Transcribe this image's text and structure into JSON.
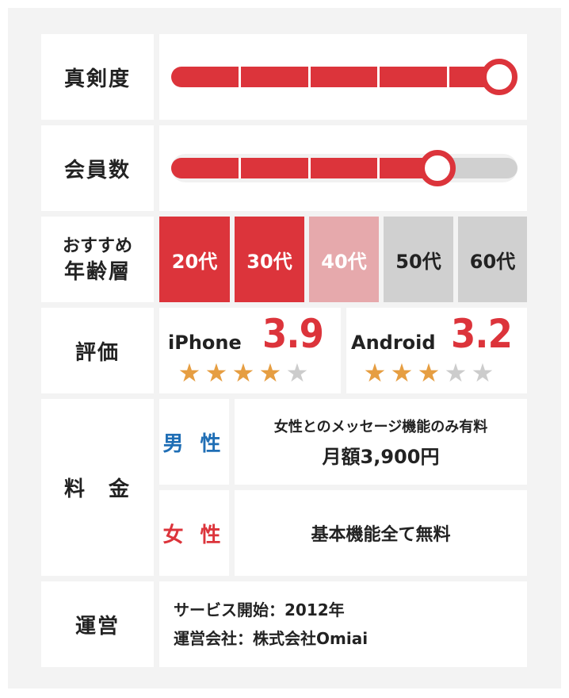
{
  "colors": {
    "accent": "#dc343b",
    "light_accent": "#e6a9ac",
    "gray": "#d0d0d0",
    "star_on": "#e69e42",
    "star_off": "#cccccc",
    "male": "#1f6eb5",
    "female": "#dc343b"
  },
  "seriousness": {
    "label": "真剣度",
    "level": 1.0,
    "segments": 5
  },
  "members": {
    "label": "会員数",
    "level": 0.8,
    "segments": 5
  },
  "age": {
    "label_line1": "おすすめ",
    "label_line2": "年齢層",
    "groups": [
      {
        "label": "20代",
        "state": "high"
      },
      {
        "label": "30代",
        "state": "high"
      },
      {
        "label": "40代",
        "state": "mid"
      },
      {
        "label": "50代",
        "state": "none"
      },
      {
        "label": "60代",
        "state": "none"
      }
    ]
  },
  "rating": {
    "label": "評価",
    "items": [
      {
        "os": "iPhone",
        "score": "3.9",
        "stars_filled": 4,
        "stars_total": 5
      },
      {
        "os": "Android",
        "score": "3.2",
        "stars_filled": 3,
        "stars_total": 5
      }
    ]
  },
  "price": {
    "label": "料　金",
    "male": {
      "label": "男 性",
      "line1": "女性とのメッセージ機能のみ有料",
      "line2": "月額3,900円"
    },
    "female": {
      "label": "女 性",
      "line1": "基本機能全て無料"
    }
  },
  "operation": {
    "label": "運営",
    "line1": "サービス開始：2012年",
    "line2": "運営会社：株式会社Omiai"
  }
}
